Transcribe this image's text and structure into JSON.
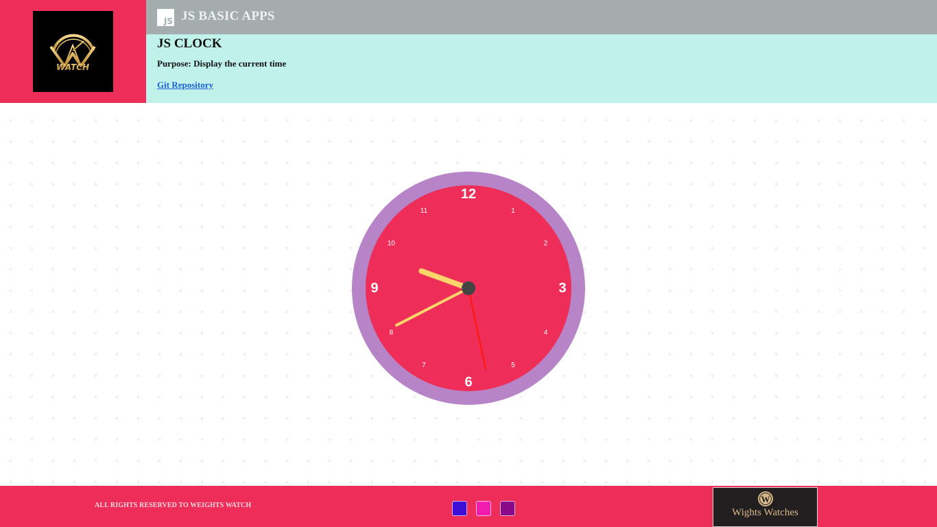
{
  "header": {
    "app_title": "JS BASIC APPS",
    "js_icon_text": "JS",
    "logo_text": "WATCH"
  },
  "info": {
    "title": "JS CLOCK",
    "purpose": "Purpose: Display the current time",
    "repo_link": "Git Repository"
  },
  "clock": {
    "numbers": [
      "12",
      "1",
      "2",
      "3",
      "4",
      "5",
      "6",
      "7",
      "8",
      "9",
      "10",
      "11"
    ],
    "time": {
      "hours": 9,
      "minutes": 40,
      "seconds": 28
    },
    "colors": {
      "face": "#ee2e58",
      "rim": "#b784c8",
      "hands": "#fdd56b",
      "second_hand": "#ff1a1a",
      "center": "#444444"
    }
  },
  "footer": {
    "copyright": "ALL RIGHTS RESERVED TO WEIGHTS WATCH",
    "swatches": [
      "#3f0fd6",
      "#f21dae",
      "#8a0a8c"
    ],
    "brand_name": "Wights Watches",
    "brand_initial": "W"
  },
  "colors": {
    "accent": "#ee2e58",
    "topbar": "#a3adad",
    "info_bg": "#c0f2eb",
    "link": "#1a5fd6"
  }
}
